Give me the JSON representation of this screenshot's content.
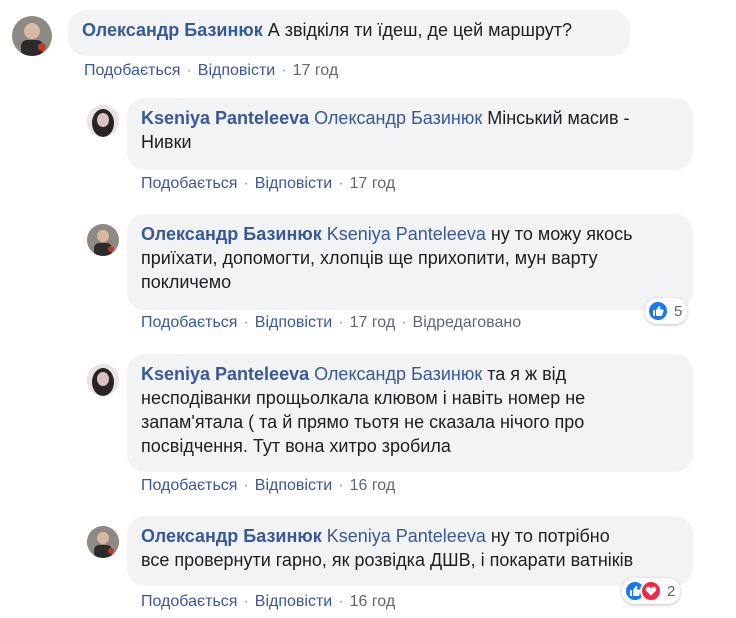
{
  "colors": {
    "link": "#385898",
    "bubble": "#f2f3f5",
    "meta": "#616770",
    "like": "#1877f2",
    "love": "#f0284a"
  },
  "comments": [
    {
      "author": "Олександр Базинюк",
      "mention": "",
      "text": "А звідкіля ти їдеш, де цей маршрут?",
      "actions": {
        "like": "Подобається",
        "reply": "Відповісти",
        "time": "17 год",
        "edited": ""
      }
    },
    {
      "author": "Kseniya Panteleeva",
      "mention": "Олександр Базинюк",
      "text": "Мінський масив -",
      "text2": "Нивки",
      "actions": {
        "like": "Подобається",
        "reply": "Відповісти",
        "time": "17 год",
        "edited": ""
      }
    },
    {
      "author": "Олександр Базинюк",
      "mention": "Kseniya Panteleeva",
      "text": "ну то можу якось",
      "text2": "приїхати, допомогти, хлопців ще прихопити, мун варту",
      "text3": "покличемо",
      "actions": {
        "like": "Подобається",
        "reply": "Відповісти",
        "time": "17 год",
        "edited": "Відредаговано"
      },
      "reactions": {
        "icons": [
          "like-icon"
        ],
        "count": "5"
      }
    },
    {
      "author": "Kseniya Panteleeva",
      "mention": "Олександр Базинюк",
      "text": "та я ж від",
      "text2": "несподіванки прощьолкала клювом і навіть номер не",
      "text3": "запам'ятала ( та й прямо тьотя не сказала нічого про",
      "text4": "посвідчення. Тут вона хитро зробила",
      "actions": {
        "like": "Подобається",
        "reply": "Відповісти",
        "time": "16 год",
        "edited": ""
      }
    },
    {
      "author": "Олександр Базинюк",
      "mention": "Kseniya Panteleeva",
      "text": "ну то потрібно",
      "text2": "все провернути гарно, як розвідка ДШВ, і покарати ватніків",
      "actions": {
        "like": "Подобається",
        "reply": "Відповісти",
        "time": "16 год",
        "edited": ""
      },
      "reactions": {
        "icons": [
          "like-icon",
          "love-icon"
        ],
        "count": "2"
      }
    }
  ]
}
